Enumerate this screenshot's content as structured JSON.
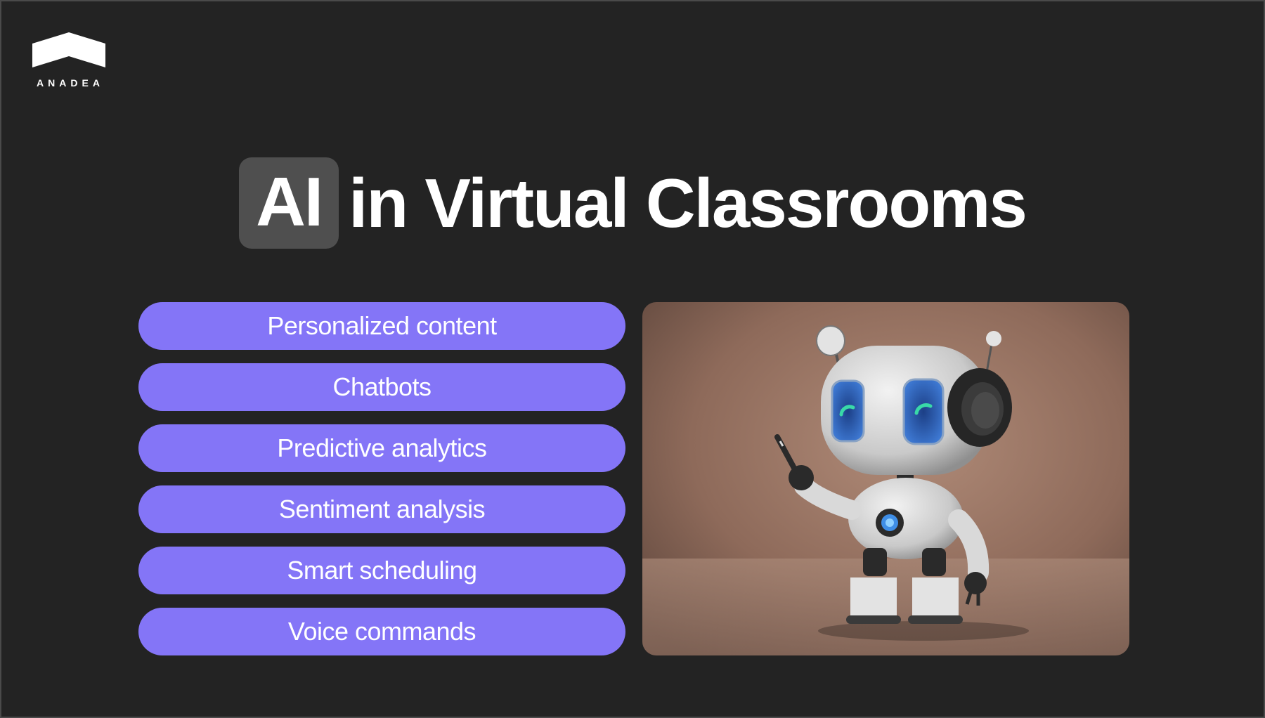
{
  "brand": {
    "name": "ANADEA"
  },
  "title": {
    "highlight": "AI",
    "rest": "in Virtual Classrooms"
  },
  "features": [
    "Personalized content",
    "Chatbots",
    "Predictive analytics",
    "Sentiment analysis",
    "Smart scheduling",
    "Voice commands"
  ],
  "colors": {
    "background": "#232323",
    "pill": "#8475f7",
    "highlight_box": "#4f4f4f",
    "text": "#ffffff"
  },
  "image": {
    "subject": "robot-illustration"
  }
}
